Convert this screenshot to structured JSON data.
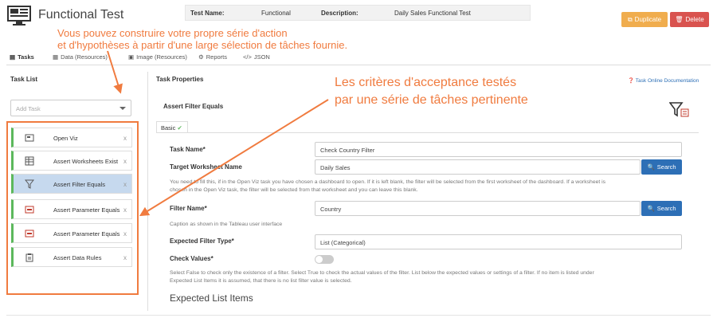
{
  "header": {
    "title": "Functional Test",
    "test_name_label": "Test Name:",
    "test_name_value": "Functional",
    "description_label": "Description:",
    "description_value": "Daily Sales Functional Test",
    "duplicate_label": "Duplicate",
    "delete_label": "Delete"
  },
  "annotations": {
    "top_line1": "Vous pouvez construire votre propre série d'action",
    "top_line2": "et d'hypothèses à partir d'une large sélection de tâches fournie.",
    "right_line1": "Les critères d'acceptance testés",
    "right_line2": "par une série de tâches pertinente"
  },
  "tabs": [
    {
      "label": "Tasks",
      "icon": "tasks-icon"
    },
    {
      "label": "Data (Resources)",
      "icon": "database-icon"
    },
    {
      "label": "Image (Resources)",
      "icon": "image-icon"
    },
    {
      "label": "Reports",
      "icon": "gear-icon"
    },
    {
      "label": "JSON",
      "icon": "code-icon"
    }
  ],
  "task_list": {
    "title": "Task List",
    "add_placeholder": "Add Task",
    "items": [
      {
        "label": "Open Viz",
        "icon": "viz-icon",
        "remove": "x"
      },
      {
        "label": "Assert Worksheets Exist",
        "icon": "worksheet-icon",
        "remove": "x"
      },
      {
        "label": "Assert Filter Equals",
        "icon": "filter-icon",
        "remove": "x"
      },
      {
        "label": "Assert Parameter Equals",
        "icon": "parameter-icon",
        "remove": "x"
      },
      {
        "label": "Assert Parameter Equals",
        "icon": "parameter-icon",
        "remove": "x"
      },
      {
        "label": "Assert Data Rules",
        "icon": "clipboard-icon",
        "remove": "x"
      }
    ]
  },
  "properties": {
    "title": "Task Properties",
    "doc_link": "Task Online Documentation",
    "task_header": "Assert Filter Equals",
    "basic_tab": "Basic",
    "fields": {
      "task_name_label": "Task Name*",
      "task_name_value": "Check Country Filter",
      "worksheet_label": "Target Worksheet Name",
      "worksheet_value": "Daily Sales",
      "search_label": "Search",
      "worksheet_help_1": "You need to fill this, if in the Open Viz task you have chosen a dashboard to open. If it is left blank, the filter will be selected from the first worksheet of the dashboard. If a worksheet is",
      "worksheet_help_2": "chosen in the Open Viz task, the filter will be selected from that worksheet and you can leave this blank.",
      "filter_name_label": "Filter Name*",
      "filter_name_value": "Country",
      "filter_help": "Caption as shown in the Tableau user interface",
      "filter_type_label": "Expected Filter Type*",
      "filter_type_value": "List (Categorical)",
      "check_values_label": "Check Values*",
      "check_values_state": false,
      "check_help_1": "Select False to check only the existence of a filter. Select True to check the actual values of the filter. List below the expected values or settings of a filter. If no item is listed under",
      "check_help_2": "Expected List Items it is assumed, that there is no list filter value is selected.",
      "expected_list_label": "Expected List Items"
    }
  },
  "colors": {
    "accent_orange": "#f07b3f",
    "duplicate": "#f0ad4e",
    "delete": "#d9534f",
    "search": "#2d6fb6",
    "task_border": "#5cb85c",
    "selected_task": "#c6d9ee"
  }
}
